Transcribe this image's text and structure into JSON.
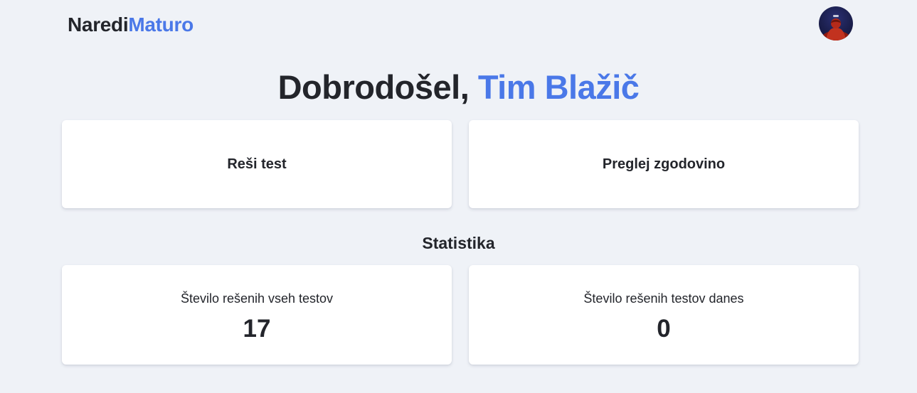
{
  "header": {
    "logo_part1": "Naredi",
    "logo_part2": "Maturo",
    "avatar_icon": "user-avatar-icon"
  },
  "welcome": {
    "greeting": "Dobrodošel, ",
    "name": "Tim Blažič"
  },
  "actions": {
    "take_test": "Reši test",
    "view_history": "Preglej zgodovino"
  },
  "stats": {
    "title": "Statistika",
    "total_label": "Število rešenih vseh testov",
    "total_value": "17",
    "today_label": "Število rešenih testov danes",
    "today_value": "0"
  },
  "colors": {
    "accent": "#4a78e8",
    "background": "#eff2f7",
    "card": "#ffffff",
    "text": "#23252b"
  }
}
